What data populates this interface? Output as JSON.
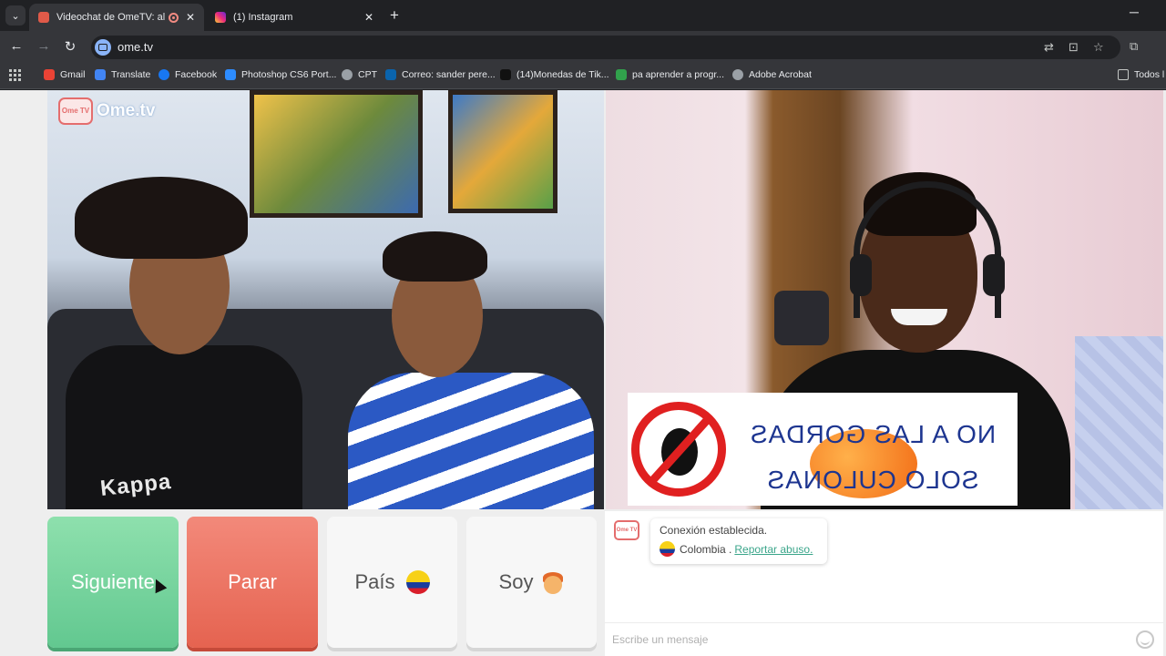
{
  "browser": {
    "tabs": [
      {
        "title": "Videochat de OmeTV: alter",
        "active": true
      },
      {
        "title": "(1) Instagram",
        "active": false
      }
    ],
    "new_tab": "+",
    "minimize": "─",
    "url": "ome.tv",
    "bookmarks": [
      {
        "label": "Gmail",
        "color": "#ea4335"
      },
      {
        "label": "Translate",
        "color": "#4285f4"
      },
      {
        "label": "Facebook",
        "color": "#1877f2"
      },
      {
        "label": "Photoshop CS6 Port...",
        "color": "#2d8cff"
      },
      {
        "label": "CPT",
        "color": "#9aa0a6"
      },
      {
        "label": "Correo: sander pere...",
        "color": "#0a64ad"
      },
      {
        "label": "(14)Monedas de Tik...",
        "color": "#111111"
      },
      {
        "label": "pa aprender a progr...",
        "color": "#31a24c"
      },
      {
        "label": "Adobe Acrobat",
        "color": "#9aa0a6"
      },
      {
        "label": "Todos l",
        "color": "#c4c7c5"
      }
    ]
  },
  "app": {
    "logo_badge": "Ome TV",
    "logo_text": "Ome.tv",
    "sign": {
      "line1": "NO A LAS GORDAS",
      "line2": "SOLO CULONAS"
    },
    "shirt_text": "Kappa",
    "buttons": {
      "next": "Siguiente",
      "stop": "Parar",
      "country": "País",
      "me": "Soy"
    },
    "chat": {
      "status": "Conexión establecida.",
      "country": "Colombia .",
      "report": "Reportar abuso.",
      "placeholder": "Escribe un mensaje"
    }
  },
  "colors": {
    "next": "#6fd29c",
    "stop": "#ea6e5b",
    "link": "#3aa58a"
  }
}
